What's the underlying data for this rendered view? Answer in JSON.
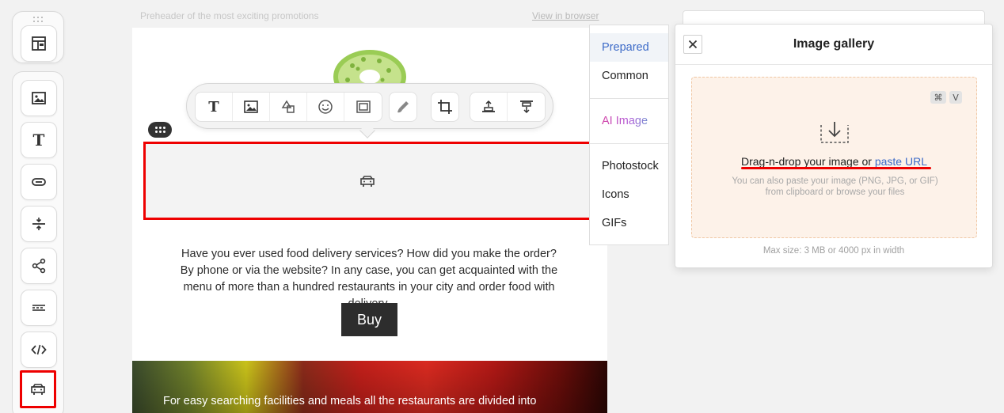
{
  "email": {
    "preheader": "Preheader of the most exciting promotions",
    "view_in_browser": "View in browser",
    "body_text": "Have you ever used food delivery services? How did you make the order? By phone or via the website? In any case, you can get acquainted with the menu of more than a hundred restaurants in your city and order food with delivery.",
    "buy_label": "Buy",
    "hero_text": "For easy searching facilities and meals all the restaurants are divided into"
  },
  "gallery_categories": {
    "prepared": "Prepared",
    "common": "Common",
    "ai_image": "AI Image",
    "photostock": "Photostock",
    "icons": "Icons",
    "gifs": "GIFs"
  },
  "gallery": {
    "title": "Image gallery",
    "drop_text": "Drag-n-drop your image or",
    "paste_url": "paste URL",
    "drop_subtext": "You can also paste your image (PNG, JPG, or GIF) from clipboard or browse your files",
    "shortcut_cmd": "⌘",
    "shortcut_key": "V",
    "max_size": "Max size: 3 MB or 4000 px in width"
  },
  "toolbar": {
    "text_glyph": "T"
  },
  "colors": {
    "highlight": "#e00000",
    "link": "#3d6bc8",
    "dropzone_bg": "#fdf2e9",
    "button_dark": "#2d2d2d"
  }
}
